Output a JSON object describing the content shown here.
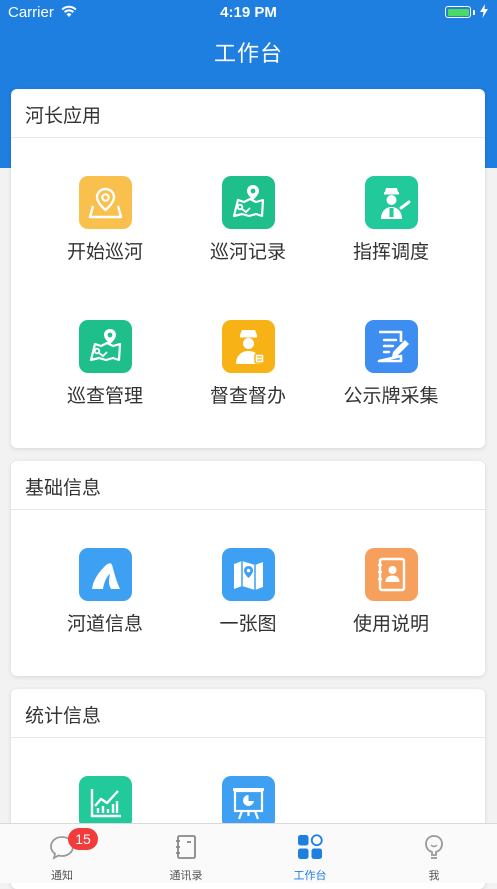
{
  "status_bar": {
    "carrier": "Carrier",
    "time": "4:19 PM",
    "battery_level": 1.0
  },
  "header": {
    "title": "工作台"
  },
  "sections": [
    {
      "title": "河长应用",
      "items": [
        {
          "label": "开始巡河",
          "icon": "map-pin-icon",
          "color": "#f9c04e"
        },
        {
          "label": "巡河记录",
          "icon": "map-route-icon",
          "color": "#1fbf8b"
        },
        {
          "label": "指挥调度",
          "icon": "traffic-police-icon",
          "color": "#22c99a"
        },
        {
          "label": "巡查管理",
          "icon": "map-route-icon",
          "color": "#1fbf8b"
        },
        {
          "label": "督查督办",
          "icon": "inspector-icon",
          "color": "#f7b315"
        },
        {
          "label": "公示牌采集",
          "icon": "edit-note-icon",
          "color": "#3d8ef0"
        }
      ]
    },
    {
      "title": "基础信息",
      "items": [
        {
          "label": "河道信息",
          "icon": "river-icon",
          "color": "#3da0f2"
        },
        {
          "label": "一张图",
          "icon": "map-icon",
          "color": "#3da0f2"
        },
        {
          "label": "使用说明",
          "icon": "contact-book-icon",
          "color": "#f7a05e"
        }
      ]
    },
    {
      "title": "统计信息",
      "items": [
        {
          "icon": "line-chart-icon",
          "color": "#22c99a"
        },
        {
          "icon": "presentation-icon",
          "color": "#3da0f2"
        }
      ]
    }
  ],
  "tab_bar": {
    "items": [
      {
        "label": "通知",
        "badge": "15",
        "icon": "chat-icon"
      },
      {
        "label": "通讯录",
        "icon": "address-book-icon"
      },
      {
        "label": "工作台",
        "icon": "workbench-icon",
        "active": true
      },
      {
        "label": "我",
        "icon": "profile-icon"
      }
    ]
  }
}
